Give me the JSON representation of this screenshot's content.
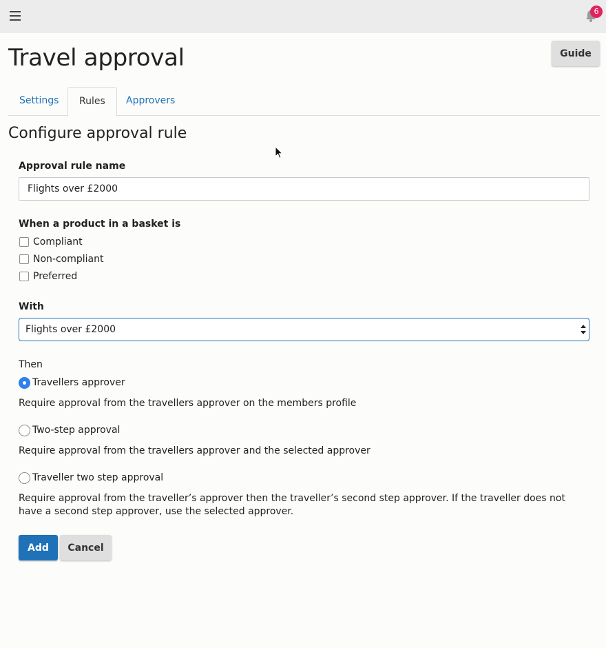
{
  "header": {
    "menu_icon": "hamburger-menu-icon",
    "bell_icon": "bell-icon",
    "notification_count": "6"
  },
  "page": {
    "title": "Travel approval",
    "guide_label": "Guide"
  },
  "tabs": [
    {
      "label": "Settings",
      "active": false
    },
    {
      "label": "Rules",
      "active": true
    },
    {
      "label": "Approvers",
      "active": false
    }
  ],
  "form": {
    "section_title": "Configure approval rule",
    "rule_name_label": "Approval rule name",
    "rule_name_value": "Flights over £2000",
    "basket_label": "When a product in a basket is",
    "checkboxes": [
      {
        "label": "Compliant",
        "checked": false
      },
      {
        "label": "Non-compliant",
        "checked": false
      },
      {
        "label": "Preferred",
        "checked": false
      }
    ],
    "with_label": "With",
    "with_selected": "Flights over £2000",
    "then_label": "Then",
    "options": [
      {
        "label": "Travellers approver",
        "checked": true,
        "description": "Require approval from the travellers approver on the members profile"
      },
      {
        "label": "Two-step approval",
        "checked": false,
        "description": "Require approval from the travellers approver and the selected approver"
      },
      {
        "label": "Traveller two step approval",
        "checked": false,
        "description": "Require approval from the traveller’s approver then the traveller’s second step approver. If the traveller does not have a second step approver, use the selected approver."
      }
    ],
    "add_label": "Add",
    "cancel_label": "Cancel"
  },
  "colors": {
    "accent": "#1f72b8",
    "radio_selected": "#2f80ed",
    "badge": "#e0245e"
  }
}
